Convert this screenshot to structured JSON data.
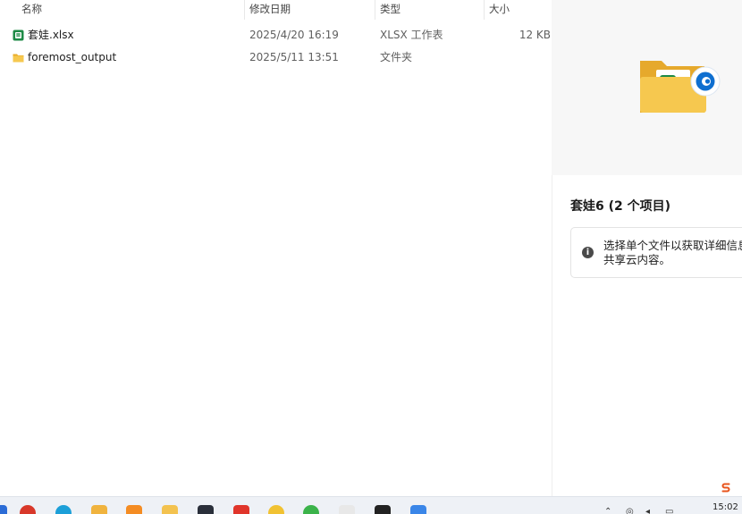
{
  "columns": {
    "name": "名称",
    "date": "修改日期",
    "type": "类型",
    "size": "大小"
  },
  "files": [
    {
      "name": "套娃.xlsx",
      "date": "2025/4/20 16:19",
      "type": "XLSX 工作表",
      "size": "12 KB",
      "icon": "excel-file-icon"
    },
    {
      "name": "foremost_output",
      "date": "2025/5/11 13:51",
      "type": "文件夹",
      "size": "",
      "icon": "folder-icon"
    }
  ],
  "details": {
    "title": "套娃6 (2 个项目)",
    "info_line1": "选择单个文件以获取详细信息",
    "info_line2": "共享云内容。"
  },
  "taskbar": {
    "time": "15:02"
  },
  "colors": {
    "excel": "#1e8a46",
    "folder": "#f3c24f",
    "edge": "#0f7bd8",
    "accent": "#0a64c8"
  }
}
